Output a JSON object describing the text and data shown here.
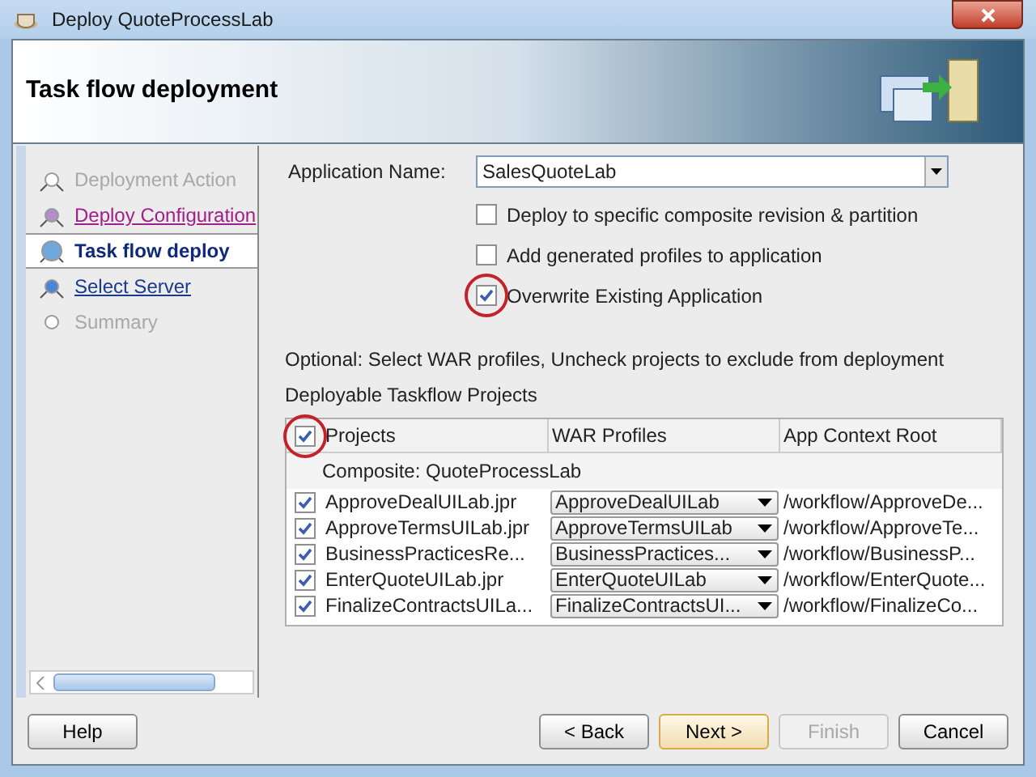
{
  "window": {
    "title": "Deploy QuoteProcessLab"
  },
  "header": {
    "title": "Task flow deployment"
  },
  "steps": [
    {
      "label": "Deployment Action",
      "kind": "done"
    },
    {
      "label": "Deploy Configuration",
      "kind": "visited"
    },
    {
      "label": "Task flow deploy",
      "kind": "current"
    },
    {
      "label": "Select Server",
      "kind": "link"
    },
    {
      "label": "Summary",
      "kind": "disabled"
    }
  ],
  "form": {
    "app_name_label": "Application Name:",
    "app_name_value": "SalesQuoteLab",
    "options": [
      {
        "label": "Deploy to specific composite revision & partition",
        "checked": false,
        "circled": false
      },
      {
        "label": "Add generated profiles to application",
        "checked": false,
        "circled": false
      },
      {
        "label": "Overwrite Existing Application",
        "checked": true,
        "circled": true
      }
    ],
    "hint": "Optional: Select WAR profiles, Uncheck projects to exclude from deployment",
    "section": "Deployable Taskflow Projects"
  },
  "table": {
    "all_checked": true,
    "header_circled": true,
    "columns": [
      "Projects",
      "WAR Profiles",
      "App Context Root"
    ],
    "group": "Composite:  QuoteProcessLab",
    "rows": [
      {
        "checked": true,
        "project": "ApproveDealUILab.jpr",
        "profile": "ApproveDealUILab",
        "root": "/workflow/ApproveDe..."
      },
      {
        "checked": true,
        "project": "ApproveTermsUILab.jpr",
        "profile": "ApproveTermsUILab",
        "root": "/workflow/ApproveTe..."
      },
      {
        "checked": true,
        "project": "BusinessPracticesRe...",
        "profile": "BusinessPractices...",
        "root": "/workflow/BusinessP..."
      },
      {
        "checked": true,
        "project": "EnterQuoteUILab.jpr",
        "profile": "EnterQuoteUILab",
        "root": "/workflow/EnterQuote..."
      },
      {
        "checked": true,
        "project": "FinalizeContractsUILa...",
        "profile": "FinalizeContractsUI...",
        "root": "/workflow/FinalizeCo..."
      }
    ]
  },
  "buttons": [
    {
      "label": "Help",
      "kind": "help",
      "disabled": false,
      "default": false
    },
    {
      "label": "< Back",
      "kind": "nav",
      "disabled": false,
      "default": false
    },
    {
      "label": "Next >",
      "kind": "nav",
      "disabled": false,
      "default": true
    },
    {
      "label": "Finish",
      "kind": "nav",
      "disabled": true,
      "default": false
    },
    {
      "label": "Cancel",
      "kind": "nav",
      "disabled": false,
      "default": false
    }
  ]
}
